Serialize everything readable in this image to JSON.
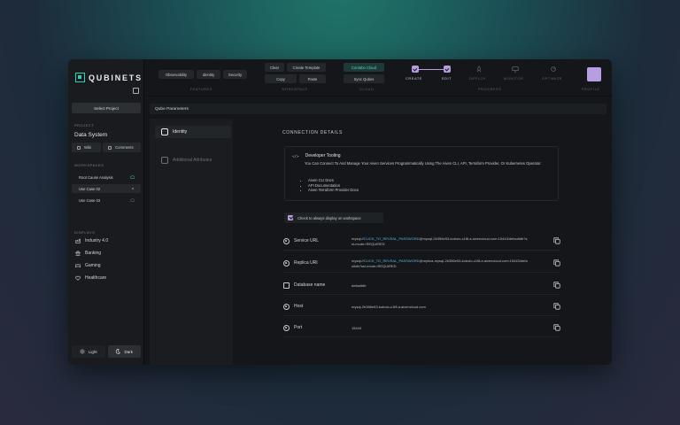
{
  "app": {
    "name": "QUBINETS"
  },
  "sidebar": {
    "select_project": "Select Project",
    "project_label": "PROJECT",
    "project_name": "Data System",
    "wiki": "Wiki",
    "comments": "Comments",
    "workspaces_label": "WORKSPACES",
    "workspaces": [
      {
        "label": "Root Cause Analysis",
        "status_icon": "cloud-icon",
        "status_color": "#2fd0b2"
      },
      {
        "label": "Use Case 02",
        "status_icon": "dot-icon",
        "status_color": "#e0525b"
      },
      {
        "label": "Use Case 03",
        "status_icon": "cloud-icon",
        "status_color": "#6b7176"
      }
    ],
    "displays_label": "DISPLAYS",
    "displays": [
      {
        "label": "Industry 4.0",
        "icon": "factory-icon"
      },
      {
        "label": "Banking",
        "icon": "bank-icon"
      },
      {
        "label": "Gaming",
        "icon": "gamepad-icon"
      },
      {
        "label": "Healthcare",
        "icon": "heart-icon"
      }
    ],
    "theme": {
      "light": "Light",
      "dark": "Dark"
    }
  },
  "topbar": {
    "features": [
      "Observability",
      "Identity",
      "Security"
    ],
    "features_label": "FEATURES",
    "workspace_actions": [
      "Clear",
      "Create Template",
      "Copy",
      "Paste"
    ],
    "workspace_label": "WORKSPACE",
    "cloud_actions": [
      "Contabo Cloud",
      "Sync Qubes"
    ],
    "cloud_label": "CLOUD",
    "progress_steps": [
      {
        "label": "CREATE",
        "done": true
      },
      {
        "label": "EDIT",
        "done": true
      },
      {
        "label": "DEPLOY",
        "done": false
      },
      {
        "label": "MONITOR",
        "done": false
      },
      {
        "label": "OPTIMIZE",
        "done": false
      }
    ],
    "progress_label": "PROGRESS",
    "profile_label": "PROFILE"
  },
  "main": {
    "header": "Qube Parameters",
    "tabs": [
      {
        "label": "Identity",
        "active": true
      },
      {
        "label": "Additional Attributes",
        "active": false
      }
    ],
    "connection_title": "CONNECTION DETAILS",
    "developer": {
      "title": "Developer Tooling",
      "code_icon": "</>",
      "description": "You Can Connect To And Manage Your Aiven Services Programmatically Using The Aiven CLI, API, Terraform Provider, Or Kubernetes Operator.",
      "links": [
        "Aiven CLI Docs",
        "API Documentation",
        "Aiven Terraform Provider Docs"
      ]
    },
    "display_toggle": "Check to always display on workspace",
    "rows": [
      {
        "label": "Service URL",
        "prefix": "mysql://",
        "highlight": "CLICK_TO_REVEAL_PASSWORD",
        "suffix": "@mysql-2b356e53-kobolo-c1f8.a.aivencloud.com:15443/defaultdb?ssl-mode=REQUIRED"
      },
      {
        "label": "Replica URI",
        "prefix": "mysql://",
        "highlight": "CLICK_TO_REVEAL_PASSWORD",
        "suffix": "@replica-mysql-2b356e53-kobolo-c1f8.a.aivencloud.com:15443/defaultdb?ssl-mode=REQUIRED"
      },
      {
        "label": "Database name",
        "prefix": "defaultdb",
        "highlight": "",
        "suffix": ""
      },
      {
        "label": "Host",
        "prefix": "mysql-2b356e53-kobolo-c1f8.a.aivencloud.com",
        "highlight": "",
        "suffix": ""
      },
      {
        "label": "Port",
        "prefix": "15443",
        "highlight": "",
        "suffix": ""
      }
    ]
  }
}
